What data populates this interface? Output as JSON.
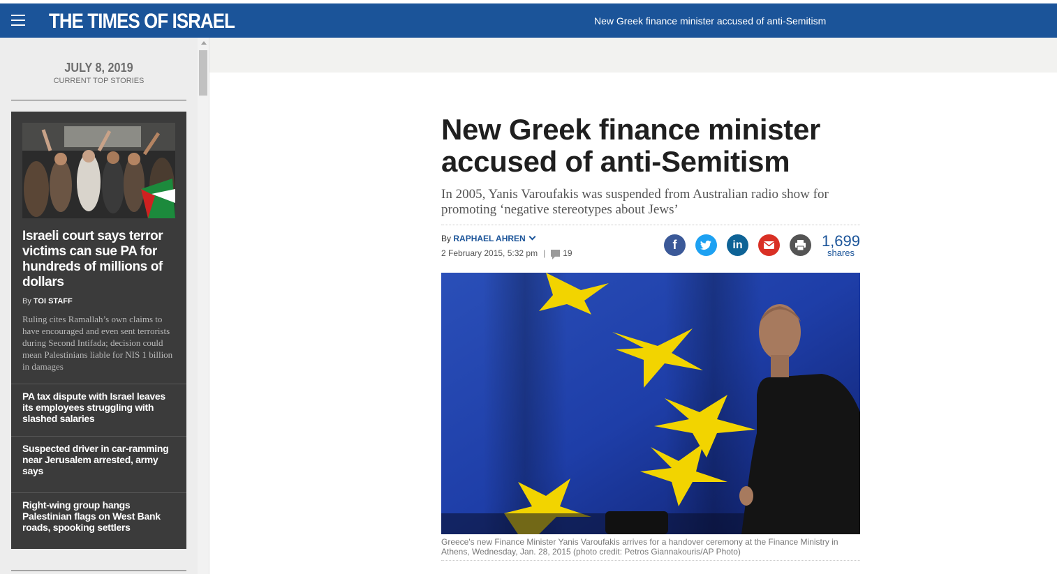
{
  "header": {
    "logo": "THE TIMES OF ISRAEL",
    "current_headline": "New Greek finance minister accused of anti-Semitism",
    "bar_color": "#1b5499"
  },
  "sidebar": {
    "date": "JULY 8, 2019",
    "date_subtitle": "CURRENT TOP STORIES",
    "main_story": {
      "title": "Israeli court says terror victims can sue PA for hundreds of millions of dollars",
      "by": "By",
      "author": "TOI STAFF",
      "summary": "Ruling cites Ramallah’s own claims to have encouraged and even sent terrorists during Second Intifada; decision could mean Palestinians liable for NIS 1 billion in damages"
    },
    "stories": [
      "PA tax dispute with Israel leaves its employees struggling with slashed salaries",
      "Suspected driver in car-ramming near Jerusalem arrested, army says",
      "Right-wing group hangs Palestinian flags on West Bank roads, spooking settlers"
    ]
  },
  "article": {
    "title": "New Greek finance minister accused of anti-Semitism",
    "subtitle": "In 2005, Yanis Varoufakis was suspended from Australian radio show for promoting ‘negative stereotypes about Jews’",
    "by": "By",
    "author": "RAPHAEL AHREN",
    "date": "2 February 2015, 5:32 pm",
    "separator": "|",
    "comments": "19",
    "share_icons": [
      "facebook-icon",
      "twitter-icon",
      "linkedin-icon",
      "mail-icon",
      "print-icon"
    ],
    "share_glyphs": {
      "facebook": "f",
      "linkedin": "in"
    },
    "shares_count": "1,699",
    "shares_label": "shares",
    "photo_caption": "Greece's new Finance Minister Yanis Varoufakis arrives for a handover ceremony at the Finance Ministry in Athens, Wednesday, Jan. 28, 2015 (photo credit: Petros Giannakouris/AP Photo)"
  }
}
